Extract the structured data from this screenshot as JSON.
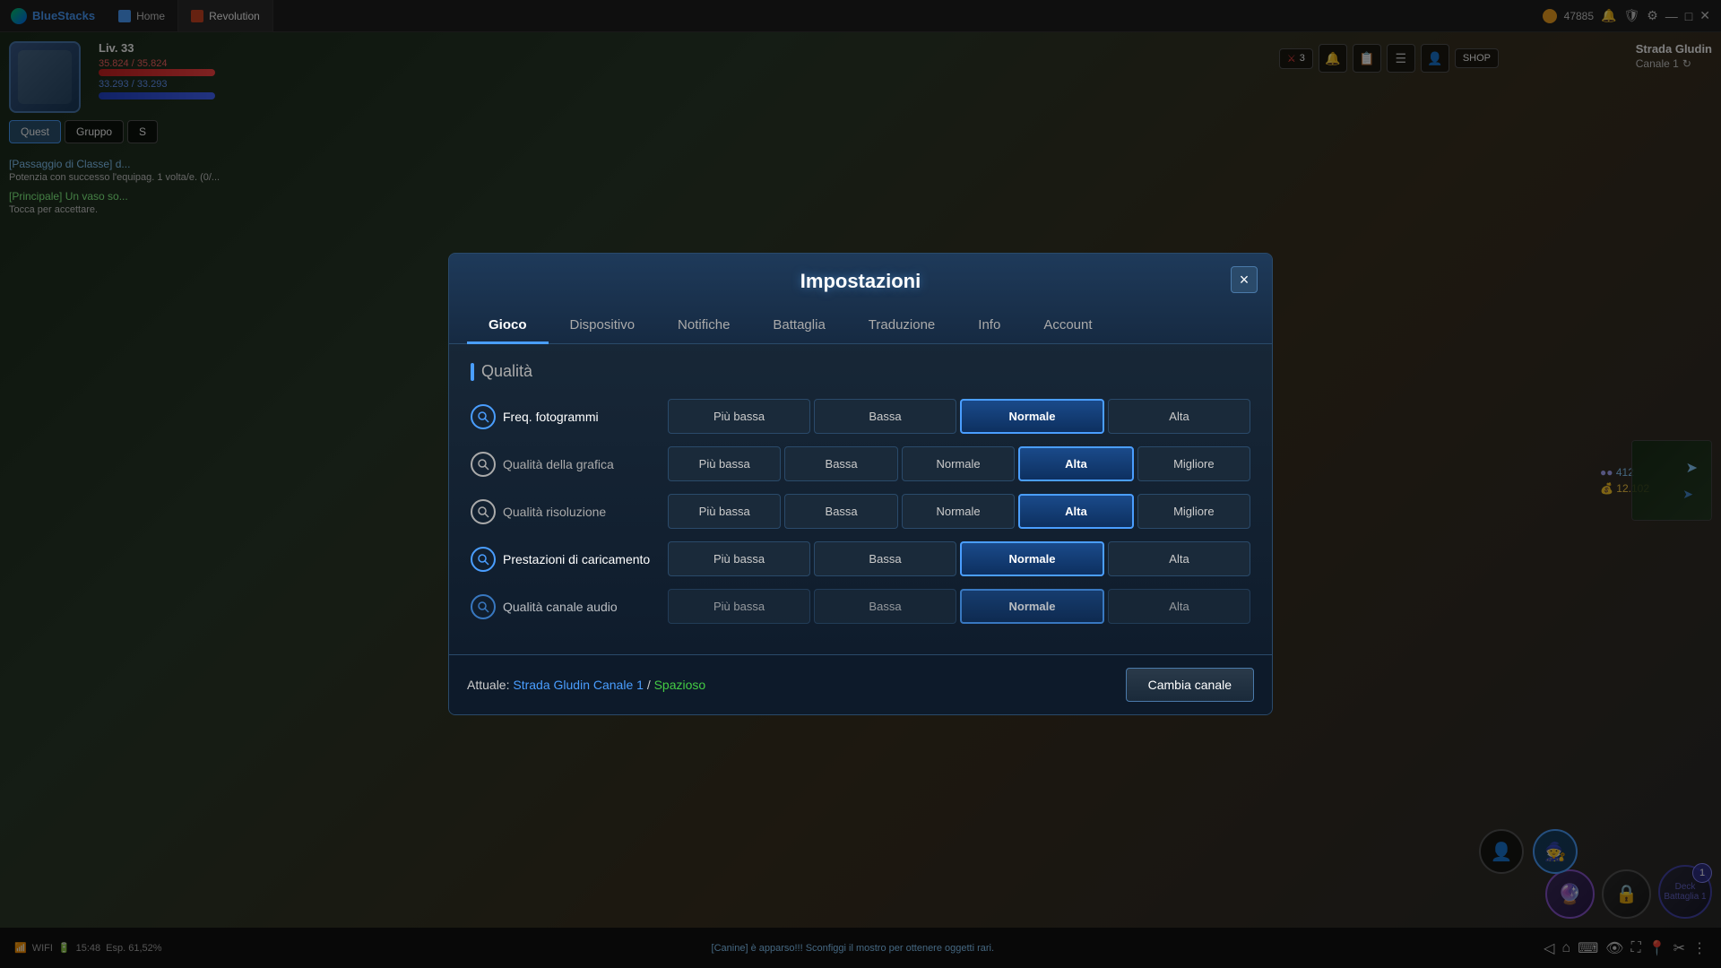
{
  "app": {
    "name": "BlueStacks",
    "coins": "47885",
    "tabs": [
      {
        "label": "Home",
        "active": false
      },
      {
        "label": "Revolution",
        "active": true
      }
    ]
  },
  "game": {
    "char_level": "Liv. 33",
    "hp": "35.824 / 35.824",
    "mp": "33.293 / 33.293",
    "location": "Strada Gludin",
    "channel": "Canale 1",
    "number": "3",
    "resources": {
      "val1": "412",
      "val2": "12.102"
    },
    "nav_buttons": [
      "Quest",
      "Gruppo",
      "S"
    ],
    "chat_message": "[Canine] è apparso!!! Sconfiggi il mostro per ottenere oggetti rari.",
    "wifi": "WIFI",
    "time": "15:48",
    "exp": "Esp. 61,52%"
  },
  "modal": {
    "title": "Impostazioni",
    "close_label": "×",
    "tabs": [
      {
        "label": "Gioco",
        "active": true
      },
      {
        "label": "Dispositivo",
        "active": false
      },
      {
        "label": "Notifiche",
        "active": false
      },
      {
        "label": "Battaglia",
        "active": false
      },
      {
        "label": "Traduzione",
        "active": false
      },
      {
        "label": "Info",
        "active": false
      },
      {
        "label": "Account",
        "active": false
      }
    ],
    "section_title": "Qualità",
    "settings": [
      {
        "label": "Freq. fotogrammi",
        "active": true,
        "options": [
          "Più bassa",
          "Bassa",
          "Normale",
          "Alta"
        ],
        "selected": 2
      },
      {
        "label": "Qualità della grafica",
        "active": false,
        "options": [
          "Più bassa",
          "Bassa",
          "Normale",
          "Alta",
          "Migliore"
        ],
        "selected": 3
      },
      {
        "label": "Qualità risoluzione",
        "active": false,
        "options": [
          "Più bassa",
          "Bassa",
          "Normale",
          "Alta",
          "Migliore"
        ],
        "selected": 3
      },
      {
        "label": "Prestazioni di caricamento",
        "active": true,
        "options": [
          "Più bassa",
          "Bassa",
          "Normale",
          "Alta"
        ],
        "selected": 2
      },
      {
        "label": "Qualità canale audio",
        "active": true,
        "options": [
          "Più bassa",
          "Bassa",
          "Normale",
          "Alta"
        ],
        "selected": 2
      }
    ],
    "bottom": {
      "prefix": "Attuale:",
      "location": "Strada Gludin Canale 1",
      "separator": "/",
      "status": "Spazioso",
      "button": "Cambia canale"
    }
  }
}
